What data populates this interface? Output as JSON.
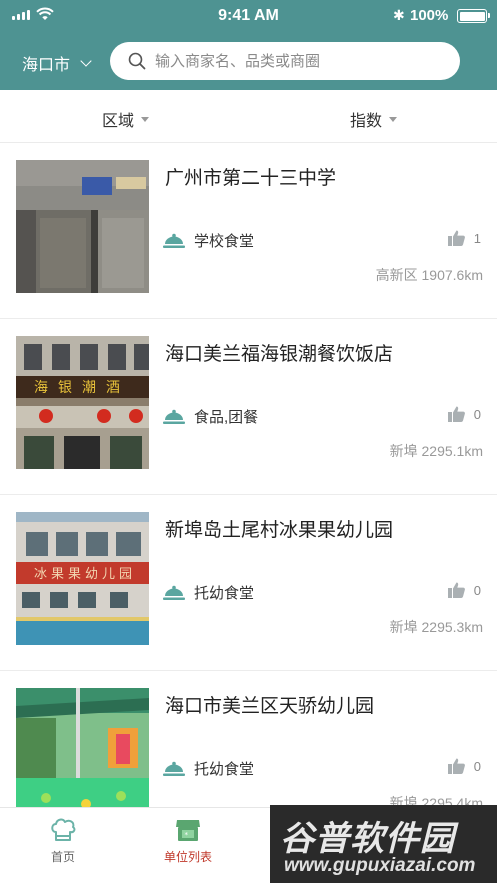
{
  "status_bar": {
    "time": "9:41 AM",
    "battery": "100%"
  },
  "header": {
    "city": "海口市",
    "search_placeholder": "输入商家名、品类或商圈"
  },
  "filters": [
    {
      "label": "区域"
    },
    {
      "label": "指数"
    }
  ],
  "items": [
    {
      "name": "广州市第二十三中学",
      "category": "学校食堂",
      "likes": "1",
      "district": "高新区",
      "distance": "1907.6km",
      "location": "高新区 1907.6km"
    },
    {
      "name": "海口美兰福海银潮餐饮饭店",
      "category": "食品,团餐",
      "likes": "0",
      "district": "新埠",
      "distance": "2295.1km",
      "location": "新埠 2295.1km",
      "sign_text": "海银潮酒"
    },
    {
      "name": "新埠岛土尾村冰果果幼儿园",
      "category": "托幼食堂",
      "likes": "0",
      "district": "新埠",
      "distance": "2295.3km",
      "location": "新埠 2295.3km",
      "sign_text": "冰果果幼儿园"
    },
    {
      "name": "海口市美兰区天骄幼儿园",
      "category": "托幼食堂",
      "likes": "0",
      "district": "新埠",
      "distance": "2295.4km",
      "location": "新埠 2295.4km"
    }
  ],
  "tabs": [
    {
      "label": "首页"
    },
    {
      "label": "单位列表"
    }
  ],
  "watermark": {
    "title": "谷普软件园",
    "url": "www.gupuxiazai.com"
  },
  "colors": {
    "header": "#4e9392",
    "accent_tab": "#c0392b",
    "category_icon": "#5aa6a0",
    "like_icon": "#aab0b3"
  },
  "icons": {
    "search": "search-icon",
    "dropdown": "caret-down-icon",
    "category": "cloche-icon",
    "like": "thumbs-up-icon",
    "home": "chef-hat-icon",
    "units": "storefront-icon"
  }
}
